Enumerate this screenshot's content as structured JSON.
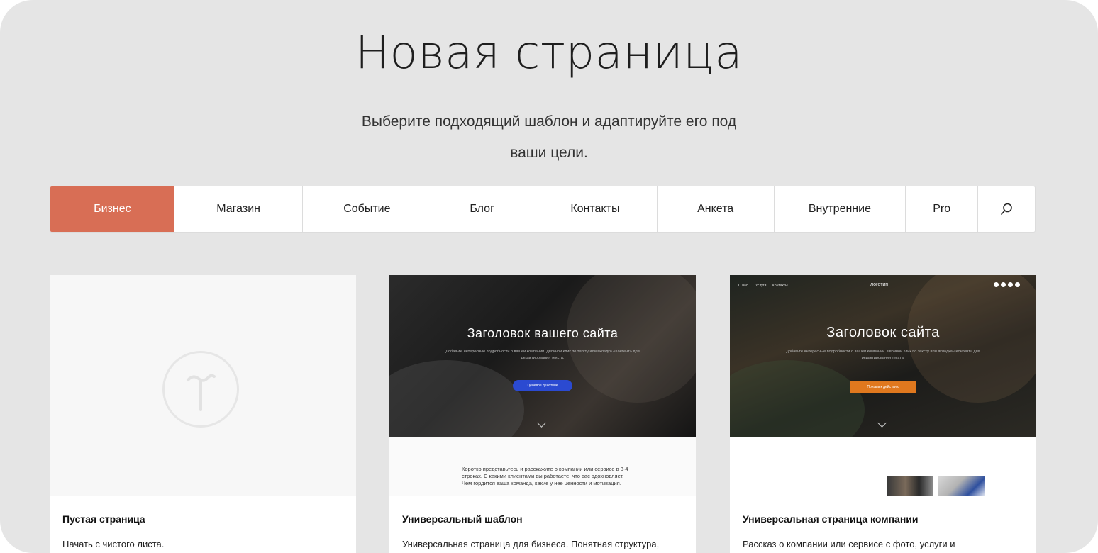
{
  "header": {
    "title": "Новая страница",
    "subtitle_line1": "Выберите подходящий шаблон и адаптируйте его под",
    "subtitle_line2": "ваши цели."
  },
  "tabs": [
    {
      "label": "Бизнес",
      "active": true
    },
    {
      "label": "Магазин"
    },
    {
      "label": "Событие"
    },
    {
      "label": "Блог"
    },
    {
      "label": "Контакты"
    },
    {
      "label": "Анкета"
    },
    {
      "label": "Внутренние"
    },
    {
      "label": "Pro"
    }
  ],
  "search_icon": "search-icon",
  "colors": {
    "accent": "#d86e55",
    "background": "#e5e5e5",
    "blue_button": "#2b4ad1",
    "orange_button": "#e0781e"
  },
  "cards": [
    {
      "title": "Пустая страница",
      "description": "Начать с чистого листа."
    },
    {
      "title": "Универсальный шаблон",
      "description": "Универсальная страница для бизнеса. Понятная структура,",
      "preview": {
        "hero_title": "Заголовок вашего сайта",
        "hero_text": "Добавьте интересные подробности о вашей компании. Двойной клик по тексту или вкладка «Контент» для редактирования текста.",
        "button_label": "Целевое действие",
        "body_text": "Коротко представьтесь и расскажите о компании или сервисе в 3-4 строках. С какими клиентами вы работаете, что вас вдохновляет. Чем гордится ваша команда, какие у нее ценности и мотивация."
      }
    },
    {
      "title": "Универсальная страница компании",
      "description": "Рассказ о компании или сервисе с фото, услуги и",
      "preview": {
        "nav": [
          "О нас",
          "Услуги",
          "Контакты"
        ],
        "logo": "логотип",
        "hero_title": "Заголовок сайта",
        "hero_text": "Добавьте интересные подробности о вашей компании. Двойной клик по тексту или вкладка «Контент» для редактирования текста.",
        "button_label": "Призыв к действию"
      }
    }
  ]
}
